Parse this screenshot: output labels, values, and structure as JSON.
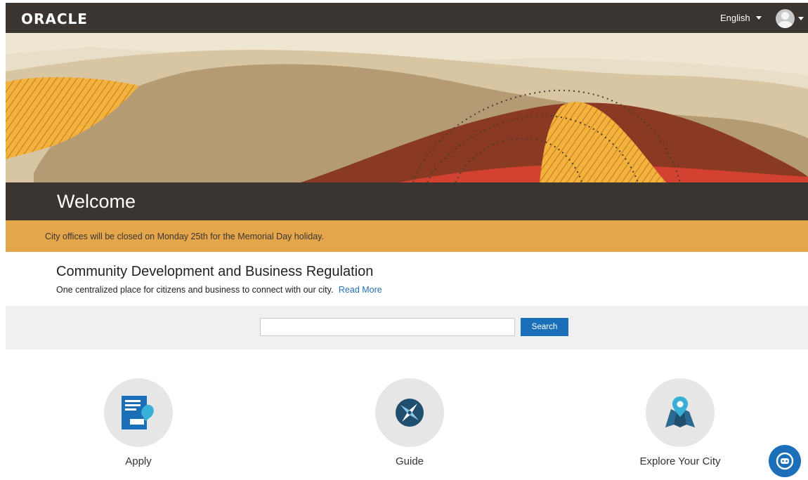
{
  "header": {
    "logo_text": "ORACLE",
    "language": "English"
  },
  "hero": {
    "welcome": "Welcome"
  },
  "notice": {
    "text": "City offices will be closed on Monday 25th for the Memorial Day holiday."
  },
  "intro": {
    "title": "Community Development and Business Regulation",
    "subtitle": "One centralized place for citizens and business to connect with our city.",
    "read_more": "Read More"
  },
  "search": {
    "placeholder": "",
    "button_label": "Search"
  },
  "tiles": [
    {
      "label": "Apply",
      "icon": "apply-form-icon"
    },
    {
      "label": "Guide",
      "icon": "compass-icon"
    },
    {
      "label": "Explore Your City",
      "icon": "map-pin-icon"
    }
  ],
  "colors": {
    "header_bg": "#3b3532",
    "notice_bg": "#e4a64b",
    "accent_blue": "#1a6fb8",
    "link_blue": "#2a6fb0"
  }
}
